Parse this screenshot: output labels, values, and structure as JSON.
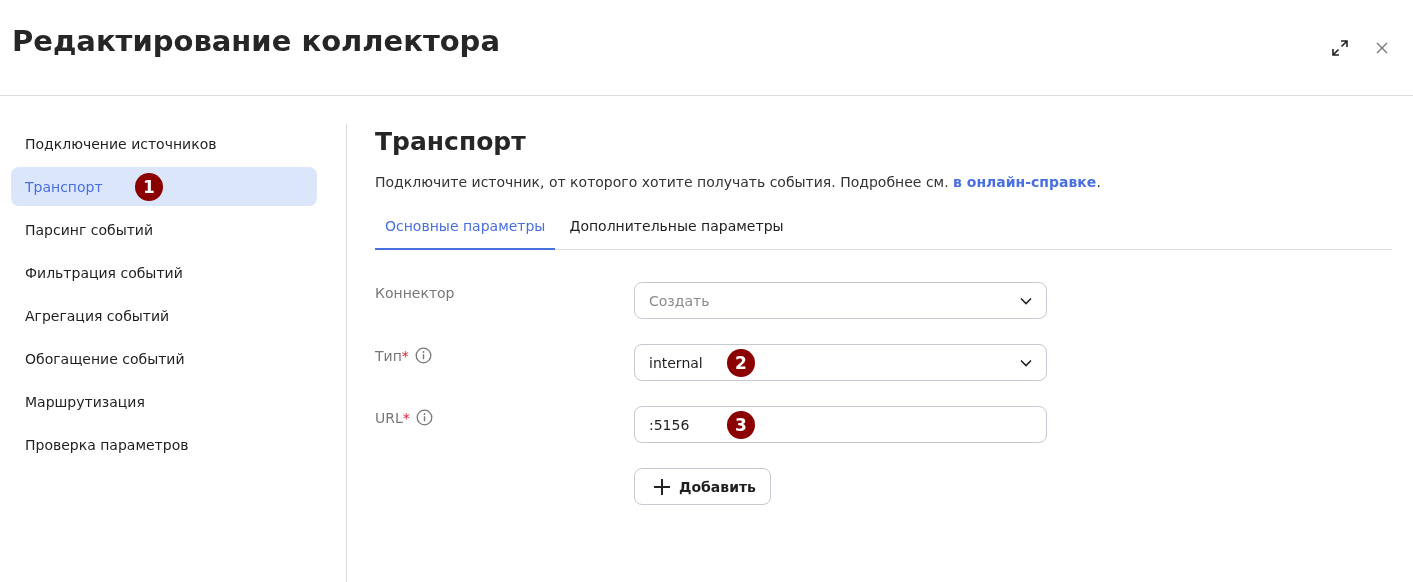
{
  "window": {
    "title": "Редактирование коллектора"
  },
  "sidebar": {
    "items": [
      {
        "label": "Подключение источников",
        "selected": false
      },
      {
        "label": "Транспорт",
        "selected": true,
        "callout": "1"
      },
      {
        "label": "Парсинг событий",
        "selected": false
      },
      {
        "label": "Фильтрация событий",
        "selected": false
      },
      {
        "label": "Агрегация событий",
        "selected": false
      },
      {
        "label": "Обогащение событий",
        "selected": false
      },
      {
        "label": "Маршрутизация",
        "selected": false
      },
      {
        "label": "Проверка параметров",
        "selected": false
      }
    ]
  },
  "section": {
    "title": "Транспорт",
    "description": "Подключите источник, от которого хотите получать события. Подробнее см. ",
    "link": "в онлайн-справке",
    "description_end": "."
  },
  "tabs": [
    {
      "label": "Основные параметры",
      "selected": true
    },
    {
      "label": "Дополнительные параметры",
      "selected": false
    }
  ],
  "form": {
    "fields": [
      {
        "kind": "select",
        "label": "Коннектор",
        "placeholder": "Создать",
        "info": false
      },
      {
        "kind": "select",
        "label": "Тип",
        "required_mark": "*",
        "value": "internal",
        "info": true,
        "callout": "2"
      },
      {
        "kind": "input",
        "label": "URL",
        "required_mark": "*",
        "value": ":5156",
        "info": true,
        "callout": "3"
      }
    ],
    "add_button": {
      "label": "Добавить"
    }
  }
}
